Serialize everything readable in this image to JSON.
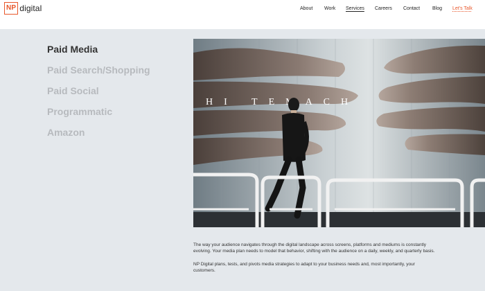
{
  "logo": {
    "box": "NP",
    "text": "digital"
  },
  "nav": {
    "items": [
      {
        "label": "About"
      },
      {
        "label": "Work"
      },
      {
        "label": "Services"
      },
      {
        "label": "Careers"
      },
      {
        "label": "Contact"
      },
      {
        "label": "Blog"
      }
    ],
    "cta": "Let's Talk"
  },
  "menu": {
    "items": [
      {
        "label": "Paid Media"
      },
      {
        "label": "Paid Search/Shopping"
      },
      {
        "label": "Paid Social"
      },
      {
        "label": "Programmatic"
      },
      {
        "label": "Amazon"
      }
    ]
  },
  "hero": {
    "banner_text": "HI  TEMACH"
  },
  "content": {
    "para1": "The way your audience navigates through the digital landscape across screens, platforms and mediums is constantly evolving. Your media plan needs to model that behavior, shifting with the audience on a daily, weekly, and quarterly basis.",
    "para2": "NP Digital plans, tests, and pivots media strategies to adapt to your business needs and, most importantly, your customers."
  },
  "colors": {
    "accent": "#e8562a",
    "page_bg": "#e4e8ec",
    "inactive_menu": "#b7babe"
  }
}
